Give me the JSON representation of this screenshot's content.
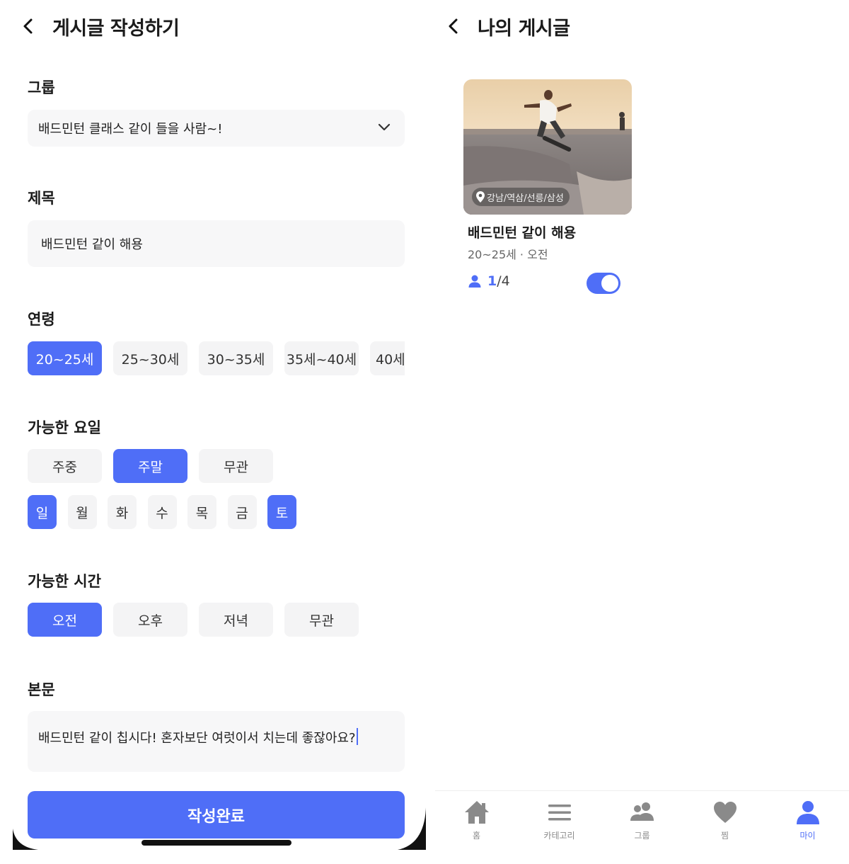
{
  "colors": {
    "accent": "#4f6ef7",
    "chip_bg": "#f4f4f5",
    "field_bg": "#f7f7f8",
    "icon_gray": "#8a8a8a"
  },
  "write_screen": {
    "title": "게시글 작성하기",
    "group": {
      "label": "그룹",
      "selected": "배드민턴 클래스 같이 들을 사람~!"
    },
    "subject": {
      "label": "제목",
      "value": "배드민턴 같이 해용"
    },
    "age": {
      "label": "연령",
      "options": [
        "20~25세",
        "25~30세",
        "30~35세",
        "35세~40세",
        "40세"
      ],
      "selected_index": 0
    },
    "days": {
      "label": "가능한 요일",
      "options": [
        "주중",
        "주말",
        "무관"
      ],
      "selected_index": 1,
      "weekdays": [
        "일",
        "월",
        "화",
        "수",
        "목",
        "금",
        "토"
      ],
      "selected_weekdays": [
        "일",
        "토"
      ]
    },
    "time": {
      "label": "가능한 시간",
      "options": [
        "오전",
        "오후",
        "저녁",
        "무관"
      ],
      "selected_index": 0
    },
    "body": {
      "label": "본문",
      "value": "배드민턴 같이 칩시다! 혼자보단 여럿이서 치는데 좋잖아요?"
    },
    "submit_label": "작성완료"
  },
  "my_posts_screen": {
    "title": "나의 게시글",
    "posts": [
      {
        "location": "강남/역삼/선릉/삼성",
        "title": "배드민턴 같이 해용",
        "meta": "20~25세 · 오전",
        "count_current": "1",
        "count_total": "/4",
        "active": true
      }
    ]
  },
  "tabbar": {
    "items": [
      {
        "label": "홈",
        "icon": "home-icon"
      },
      {
        "label": "카테고리",
        "icon": "menu-icon"
      },
      {
        "label": "그룹",
        "icon": "group-icon"
      },
      {
        "label": "찜",
        "icon": "heart-icon"
      },
      {
        "label": "마이",
        "icon": "person-icon"
      }
    ],
    "active_index": 4
  }
}
